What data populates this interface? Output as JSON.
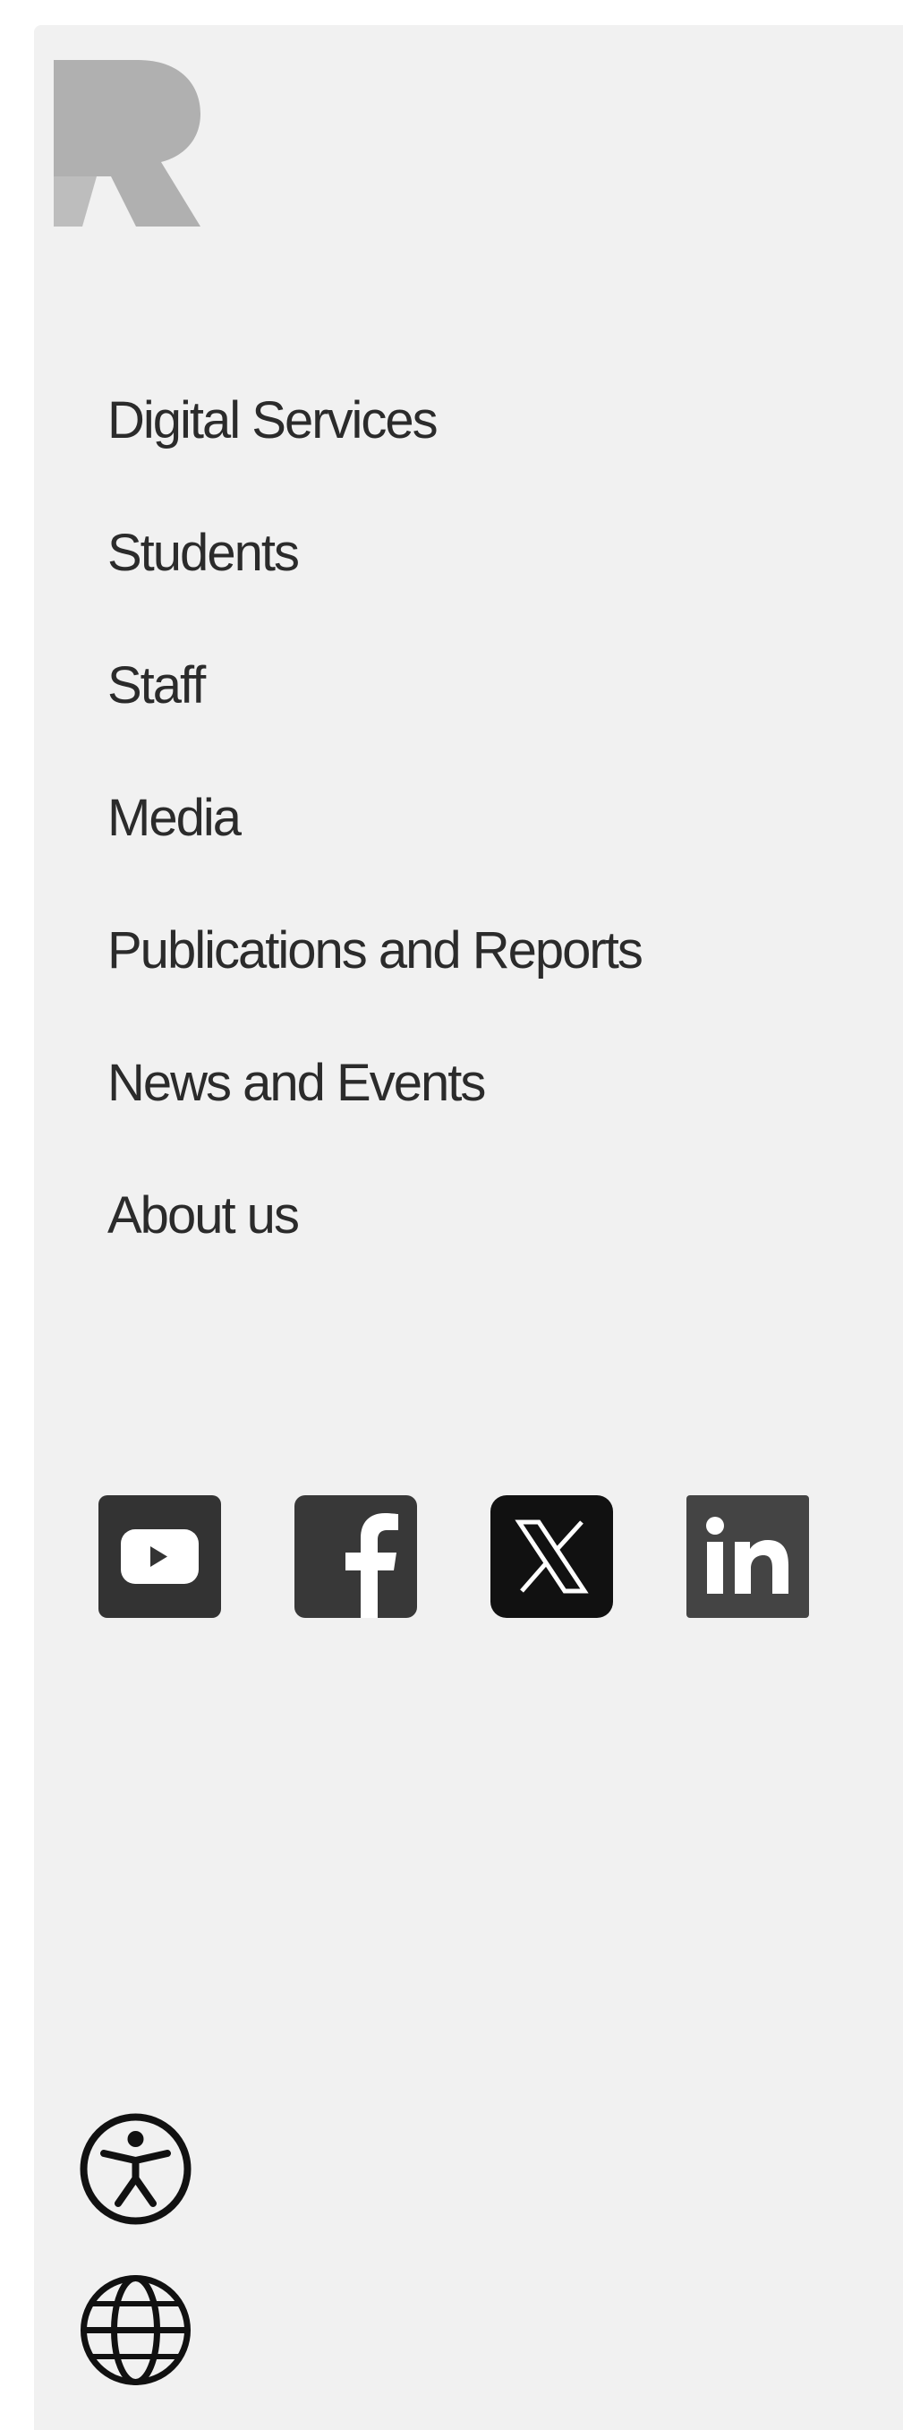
{
  "brand": {
    "logo_icon": "r-logo-icon"
  },
  "nav": {
    "items": [
      {
        "label": "Digital Services"
      },
      {
        "label": "Students"
      },
      {
        "label": "Staff"
      },
      {
        "label": "Media"
      },
      {
        "label": "Publications and Reports"
      },
      {
        "label": "News and Events"
      },
      {
        "label": "About us"
      }
    ]
  },
  "social": {
    "icons": [
      "youtube-icon",
      "facebook-icon",
      "x-icon",
      "linkedin-icon"
    ]
  },
  "utility": {
    "icons": [
      "accessibility-icon",
      "globe-icon"
    ]
  },
  "colors": {
    "panel_bg": "#f1f1f1",
    "text": "#2b2b2b",
    "logo": "#b0b0b0",
    "icon_dark": "#333333",
    "icon_black": "#111111"
  }
}
